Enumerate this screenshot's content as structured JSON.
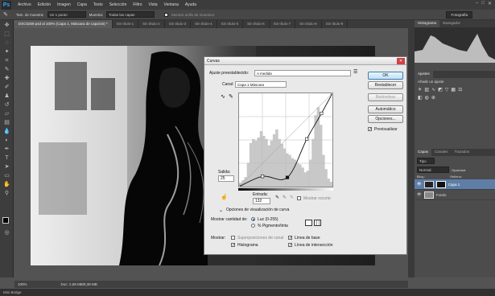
{
  "app": {
    "logo": "Ps",
    "menu": [
      "Archivo",
      "Edición",
      "Imagen",
      "Capa",
      "Texto",
      "Selección",
      "Filtro",
      "Vista",
      "Ventana",
      "Ayuda"
    ]
  },
  "options_bar": {
    "sample_size_label": "Tam. de muestra:",
    "sample_size_value": "Un 1 punto",
    "sample_label": "Muestra:",
    "sample_value": "Todas las capas",
    "ring_label": "Mostrar anillo de muestreo",
    "workspace": "Fotografía"
  },
  "tabs": [
    "DSC5259.psd al 100% (Capa 1, Máscara de capa/16) *",
    "Sin título-1",
    "Sin título-2",
    "Sin título-3",
    "Sin título-4",
    "Sin título-5",
    "Sin título-6",
    "Sin título-7",
    "Sin título-8",
    "Sin título-9"
  ],
  "status": {
    "zoom": "100%",
    "doc": "Doc: 2,59 MB/8,38 MB"
  },
  "mini_bridge": "Mini Bridge",
  "curves_dialog": {
    "title": "Curvas",
    "preset_label": "Ajuste preestablecido:",
    "preset_value": "A medida",
    "channel_label": "Canal:",
    "channel_value": "Capa 1 Máscara",
    "output_label": "Salida:",
    "output_value": "25",
    "input_label": "Entrada:",
    "input_value": "132",
    "show_clipping": "Mostrar recorte",
    "display_options": "Opciones de visualización de curva",
    "show_amount_label": "Mostrar cantidad de:",
    "light_option": "Luz (0-255)",
    "pigment_option": "% Pigmento/tinta",
    "show_label": "Mostrar:",
    "channel_overlays": "Superposiciones de canal",
    "baseline": "Línea de base",
    "histogram": "Histograma",
    "intersection": "Línea de intersección",
    "buttons": {
      "ok": "OK",
      "cancel": "Restablecer",
      "smooth": "Redondear",
      "auto": "Automático",
      "options": "Opciones...",
      "preview": "Previsualizar"
    },
    "curve_points": [
      [
        0,
        0
      ],
      [
        64,
        28
      ],
      [
        132,
        25
      ],
      [
        185,
        130
      ],
      [
        225,
        200
      ],
      [
        255,
        255
      ]
    ],
    "histogram_bins": [
      5,
      8,
      12,
      30,
      55,
      60,
      58,
      62,
      70,
      64,
      60,
      52,
      58,
      66,
      72,
      60,
      54,
      48,
      42,
      40,
      36,
      34,
      30,
      28,
      24,
      18,
      20,
      34,
      60,
      90,
      100,
      78,
      40,
      22,
      10,
      6
    ]
  },
  "panels": {
    "top_tabs": [
      "Histograma",
      "Navegador"
    ],
    "adjust_tab": "Ajustes",
    "adjust_sub": "Añadir un ajuste",
    "layer_tabs": [
      "Capas",
      "Canales",
      "Trazados"
    ],
    "kind_label": "Tipo",
    "blend_mode": "Normal",
    "opacity_label": "Opacidad:",
    "lock_label": "Bloq.:",
    "fill_label": "Relleno:",
    "layers": [
      {
        "name": "Capa 1"
      },
      {
        "name": "Fondo"
      }
    ]
  }
}
